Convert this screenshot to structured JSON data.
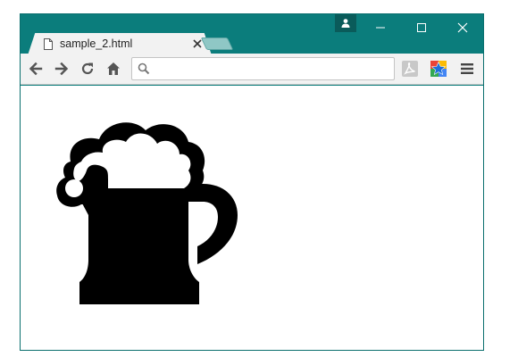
{
  "tab": {
    "title": "sample_2.html"
  },
  "omnibox": {
    "value": "",
    "placeholder": ""
  },
  "icons": {
    "profile": "person-icon",
    "minimize": "minimize-icon",
    "maximize": "maximize-icon",
    "close": "close-icon",
    "page": "page-icon",
    "tab_close": "close-icon",
    "back": "arrow-left-icon",
    "forward": "arrow-right-icon",
    "reload": "reload-icon",
    "home": "home-icon",
    "search": "search-icon",
    "pdf_extension": "pdf-extension-icon",
    "bookmark_extension": "star-extension-icon",
    "menu": "hamburger-menu-icon",
    "content_image": "beer-mug-icon"
  },
  "colors": {
    "titlebar": "#0b7d7c",
    "tab": "#f2f2f2",
    "newtab": "#8fc7c5",
    "content_background": "#ffffff",
    "image_fill": "#000000"
  }
}
